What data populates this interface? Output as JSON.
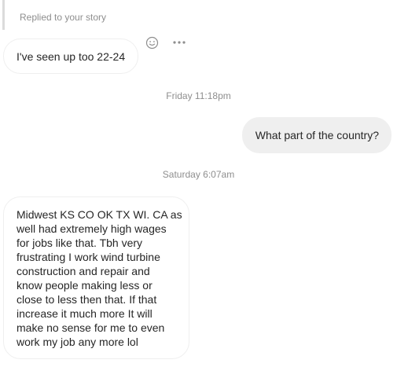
{
  "story_reply": {
    "label": "Replied to your story"
  },
  "messages": [
    {
      "direction": "incoming",
      "text": "I've seen up too 22-24"
    },
    {
      "timestamp": "Friday 11:18pm"
    },
    {
      "direction": "outgoing",
      "text": "What part of the country?"
    },
    {
      "timestamp": "Saturday 6:07am"
    },
    {
      "direction": "incoming",
      "lines": [
        "Midwest KS CO OK TX WI. CA as",
        "well had extremely high wages",
        "for jobs like that. Tbh very",
        "frustrating I work wind turbine",
        "construction and repair and",
        "know people making less or",
        "close to less then that. If that",
        "increase it much more It will",
        "make no sense for me to even",
        "work my job any more lol"
      ]
    }
  ],
  "message_actions": {
    "icons": [
      "emoji-react-icon",
      "more-options-icon"
    ]
  },
  "colors": {
    "incoming_bubble_border": "#efefef",
    "outgoing_bubble_bg": "#efefef",
    "meta_text": "#8e8e8e",
    "message_text": "#262626",
    "reply_bar": "#dbdbdb"
  }
}
